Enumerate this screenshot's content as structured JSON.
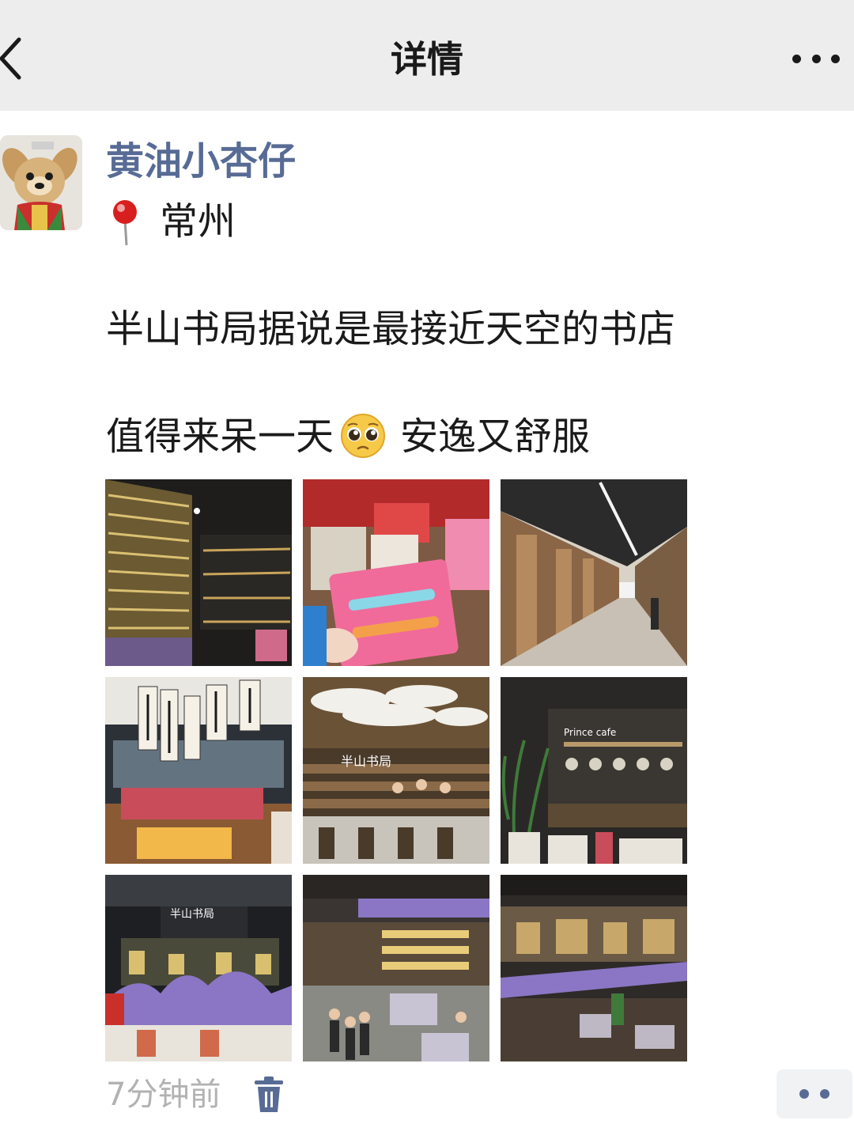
{
  "nav": {
    "title": "详情",
    "back_icon": "chevron-left-icon",
    "more_icon": "more-dots-icon"
  },
  "post": {
    "user_name": "黄油小杏仔",
    "location_icon": "map-pin-icon",
    "location": "常州",
    "text_line_1": "半山书局据说是最接近天空的书店",
    "text_line_2_part_1": "值得来呆一天",
    "emoji_icon": "pleading-face-emoji",
    "text_line_2_part_2": "安逸又舒服",
    "photos": [
      {
        "subject": "bookshelf-wall-photo"
      },
      {
        "subject": "souvenir-cards-photo"
      },
      {
        "subject": "corridor-photo"
      },
      {
        "subject": "banners-shop-photo"
      },
      {
        "subject": "stairs-seating-photo",
        "caption": "半山书局"
      },
      {
        "subject": "cafe-counter-photo",
        "caption": "Prince cafe"
      },
      {
        "subject": "entrance-display-photo",
        "caption": "半山书局"
      },
      {
        "subject": "atrium-hall-photo"
      },
      {
        "subject": "multi-level-hall-photo"
      }
    ],
    "timestamp": "7分钟前",
    "delete_icon": "trash-icon",
    "action_icon": "comment-like-dots-icon"
  },
  "colors": {
    "nav_bg": "#ededed",
    "link_blue": "#576b95",
    "muted_gray": "#b2b2b2",
    "text": "#1a1a1a"
  }
}
